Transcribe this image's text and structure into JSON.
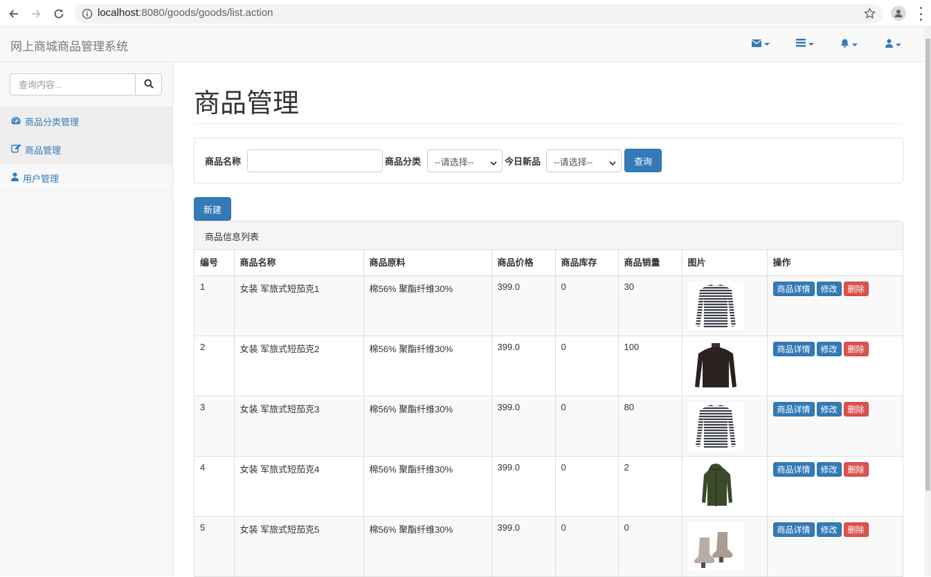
{
  "browser": {
    "url_host": "localhost",
    "url_rest": ":8080/goods/goods/list.action"
  },
  "navbar": {
    "brand": "网上商城商品管理系统"
  },
  "sidebar": {
    "search_placeholder": "查询内容...",
    "items": [
      {
        "label": "商品分类管理",
        "icon": "dashboard-icon"
      },
      {
        "label": "商品管理",
        "icon": "edit-icon"
      },
      {
        "label": "用户管理",
        "icon": "user-icon"
      }
    ]
  },
  "main": {
    "title": "商品管理",
    "filter": {
      "name_label": "商品名称",
      "category_label": "商品分类",
      "category_value": "--请选择--",
      "new_label": "今日新品",
      "new_value": "--请选择--",
      "query_button": "查询"
    },
    "new_button": "新建",
    "panel_title": "商品信息列表",
    "table": {
      "headers": [
        "编号",
        "商品名称",
        "商品原料",
        "商品价格",
        "商品库存",
        "商品销量",
        "图片",
        "操作"
      ],
      "rows": [
        {
          "id": "1",
          "name": "女装 军旅式短茄克1",
          "material": "棉56% 聚酯纤维30%",
          "price": "399.0",
          "stock": "0",
          "sales": "30",
          "image": "striped-sweater"
        },
        {
          "id": "2",
          "name": "女装 军旅式短茄克2",
          "material": "棉56% 聚酯纤维30%",
          "price": "399.0",
          "stock": "0",
          "sales": "100",
          "image": "black-turtleneck"
        },
        {
          "id": "3",
          "name": "女装 军旅式短茄克3",
          "material": "棉56% 聚酯纤维30%",
          "price": "399.0",
          "stock": "0",
          "sales": "80",
          "image": "striped-sweater"
        },
        {
          "id": "4",
          "name": "女装 军旅式短茄克4",
          "material": "棉56% 聚酯纤维30%",
          "price": "399.0",
          "stock": "0",
          "sales": "2",
          "image": "green-jacket"
        },
        {
          "id": "5",
          "name": "女装 军旅式短茄克5",
          "material": "棉56% 聚酯纤维30%",
          "price": "399.0",
          "stock": "0",
          "sales": "0",
          "image": "ankle-boots"
        }
      ],
      "actions": {
        "detail": "商品详情",
        "edit": "修改",
        "delete": "删除"
      }
    }
  },
  "colors": {
    "primary": "#337ab7",
    "danger": "#d9534f"
  }
}
